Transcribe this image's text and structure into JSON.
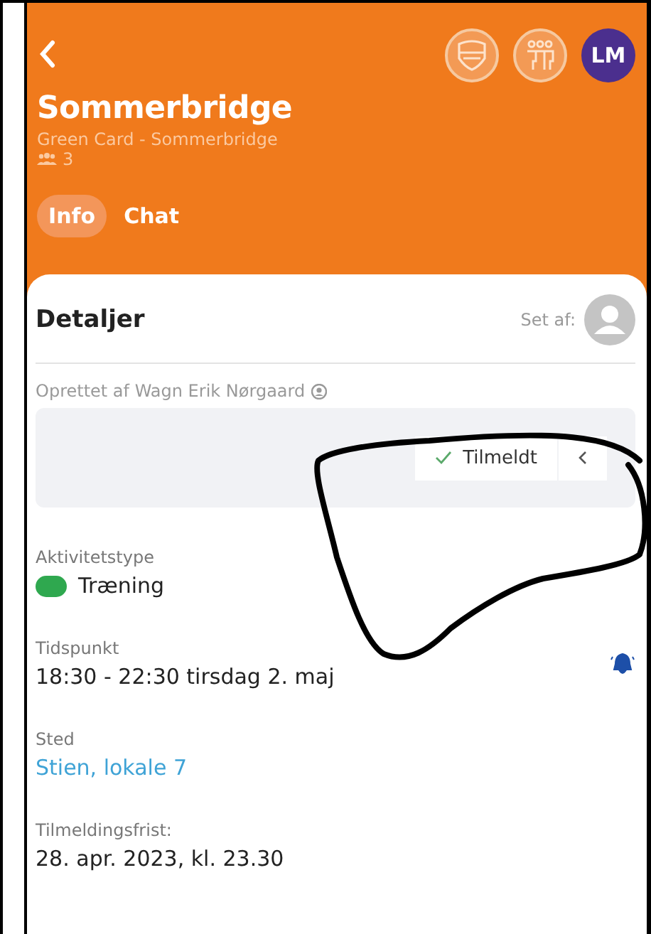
{
  "header": {
    "title": "Sommerbridge",
    "subtitle": "Green Card - Sommerbridge",
    "member_count": "3",
    "avatar_initials": "LM"
  },
  "tabs": [
    {
      "label": "Info",
      "selected": true
    },
    {
      "label": "Chat",
      "selected": false
    }
  ],
  "details": {
    "heading": "Detaljer",
    "seen_by_label": "Set af:",
    "created_by": "Oprettet af Wagn Erik Nørgaard",
    "signup_button": {
      "label": "Tilmeldt",
      "checked": true
    }
  },
  "fields": [
    {
      "kind": "type",
      "label": "Aktivitetstype",
      "value": "Træning",
      "color": "#2fa84f"
    },
    {
      "kind": "time",
      "label": "Tidspunkt",
      "value": "18:30 - 22:30 tirsdag 2. maj"
    },
    {
      "kind": "link",
      "label": "Sted",
      "value": "Stien, lokale 7"
    },
    {
      "kind": "text",
      "label": "Tilmeldingsfrist:",
      "value": "28. apr. 2023, kl. 23.30"
    }
  ]
}
